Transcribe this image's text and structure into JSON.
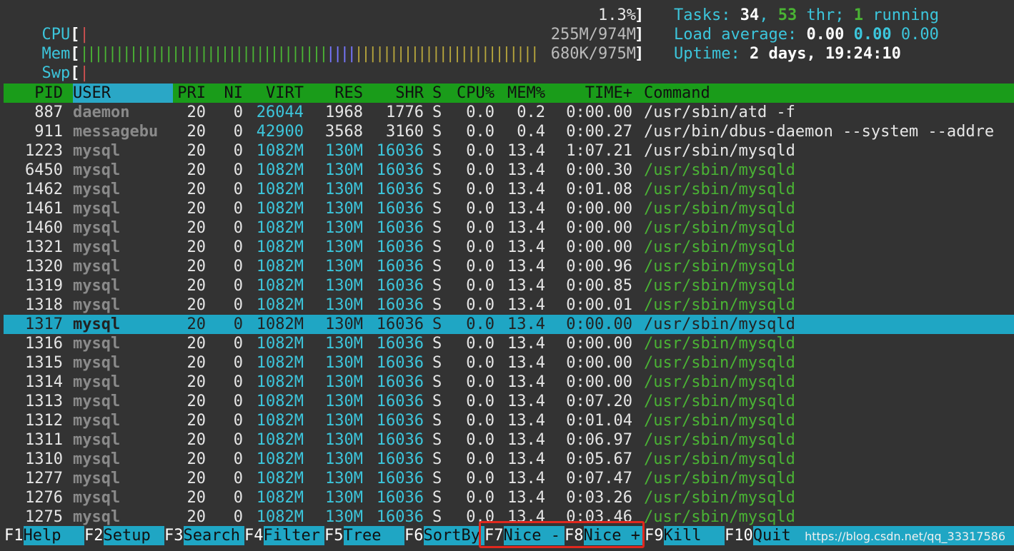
{
  "meters": {
    "cpu": {
      "label": "CPU",
      "percent": "1.3%"
    },
    "mem": {
      "label": "Mem",
      "value": "255M/974M"
    },
    "swp": {
      "label": "Swp",
      "value": "680K/975M"
    }
  },
  "summary": {
    "tasks_label": "Tasks:",
    "tasks": "34",
    "threads": "53",
    "thr_label": "thr;",
    "running": "1",
    "running_label": "running",
    "load_label": "Load average:",
    "load1": "0.00",
    "load5": "0.00",
    "load15": "0.00",
    "uptime_label": "Uptime:",
    "uptime": "2 days, 19:24:10"
  },
  "columns": {
    "pid": "PID",
    "user": "USER",
    "pri": "PRI",
    "ni": "NI",
    "virt": "VIRT",
    "res": "RES",
    "shr": "SHR",
    "s": "S",
    "cpu": "CPU%",
    "mem": "MEM%",
    "time": "TIME+",
    "command": "Command"
  },
  "processes": [
    {
      "pid": "887",
      "user": "daemon",
      "pri": "20",
      "ni": "0",
      "virt": "26044",
      "res": "1968",
      "shr": "1776",
      "s": "S",
      "cpu": "0.0",
      "mem": "0.2",
      "time": "0:00.00",
      "command": "/usr/sbin/atd -f",
      "thread": false
    },
    {
      "pid": "911",
      "user": "messagebu",
      "pri": "20",
      "ni": "0",
      "virt": "42900",
      "res": "3568",
      "shr": "3160",
      "s": "S",
      "cpu": "0.0",
      "mem": "0.4",
      "time": "0:00.27",
      "command": "/usr/bin/dbus-daemon --system --addre",
      "thread": false
    },
    {
      "pid": "1223",
      "user": "mysql",
      "pri": "20",
      "ni": "0",
      "virt": "1082M",
      "res": "130M",
      "shr": "16036",
      "s": "S",
      "cpu": "0.0",
      "mem": "13.4",
      "time": "1:07.21",
      "command": "/usr/sbin/mysqld",
      "thread": false
    },
    {
      "pid": "6450",
      "user": "mysql",
      "pri": "20",
      "ni": "0",
      "virt": "1082M",
      "res": "130M",
      "shr": "16036",
      "s": "S",
      "cpu": "0.0",
      "mem": "13.4",
      "time": "0:00.30",
      "command": "/usr/sbin/mysqld",
      "thread": true
    },
    {
      "pid": "1462",
      "user": "mysql",
      "pri": "20",
      "ni": "0",
      "virt": "1082M",
      "res": "130M",
      "shr": "16036",
      "s": "S",
      "cpu": "0.0",
      "mem": "13.4",
      "time": "0:01.08",
      "command": "/usr/sbin/mysqld",
      "thread": true
    },
    {
      "pid": "1461",
      "user": "mysql",
      "pri": "20",
      "ni": "0",
      "virt": "1082M",
      "res": "130M",
      "shr": "16036",
      "s": "S",
      "cpu": "0.0",
      "mem": "13.4",
      "time": "0:00.00",
      "command": "/usr/sbin/mysqld",
      "thread": true
    },
    {
      "pid": "1460",
      "user": "mysql",
      "pri": "20",
      "ni": "0",
      "virt": "1082M",
      "res": "130M",
      "shr": "16036",
      "s": "S",
      "cpu": "0.0",
      "mem": "13.4",
      "time": "0:00.00",
      "command": "/usr/sbin/mysqld",
      "thread": true
    },
    {
      "pid": "1321",
      "user": "mysql",
      "pri": "20",
      "ni": "0",
      "virt": "1082M",
      "res": "130M",
      "shr": "16036",
      "s": "S",
      "cpu": "0.0",
      "mem": "13.4",
      "time": "0:00.00",
      "command": "/usr/sbin/mysqld",
      "thread": true
    },
    {
      "pid": "1320",
      "user": "mysql",
      "pri": "20",
      "ni": "0",
      "virt": "1082M",
      "res": "130M",
      "shr": "16036",
      "s": "S",
      "cpu": "0.0",
      "mem": "13.4",
      "time": "0:00.96",
      "command": "/usr/sbin/mysqld",
      "thread": true
    },
    {
      "pid": "1319",
      "user": "mysql",
      "pri": "20",
      "ni": "0",
      "virt": "1082M",
      "res": "130M",
      "shr": "16036",
      "s": "S",
      "cpu": "0.0",
      "mem": "13.4",
      "time": "0:00.85",
      "command": "/usr/sbin/mysqld",
      "thread": true
    },
    {
      "pid": "1318",
      "user": "mysql",
      "pri": "20",
      "ni": "0",
      "virt": "1082M",
      "res": "130M",
      "shr": "16036",
      "s": "S",
      "cpu": "0.0",
      "mem": "13.4",
      "time": "0:00.01",
      "command": "/usr/sbin/mysqld",
      "thread": true
    },
    {
      "pid": "1317",
      "user": "mysql",
      "pri": "20",
      "ni": "0",
      "virt": "1082M",
      "res": "130M",
      "shr": "16036",
      "s": "S",
      "cpu": "0.0",
      "mem": "13.4",
      "time": "0:00.00",
      "command": "/usr/sbin/mysqld",
      "thread": true,
      "selected": true
    },
    {
      "pid": "1316",
      "user": "mysql",
      "pri": "20",
      "ni": "0",
      "virt": "1082M",
      "res": "130M",
      "shr": "16036",
      "s": "S",
      "cpu": "0.0",
      "mem": "13.4",
      "time": "0:00.00",
      "command": "/usr/sbin/mysqld",
      "thread": true
    },
    {
      "pid": "1315",
      "user": "mysql",
      "pri": "20",
      "ni": "0",
      "virt": "1082M",
      "res": "130M",
      "shr": "16036",
      "s": "S",
      "cpu": "0.0",
      "mem": "13.4",
      "time": "0:00.00",
      "command": "/usr/sbin/mysqld",
      "thread": true
    },
    {
      "pid": "1314",
      "user": "mysql",
      "pri": "20",
      "ni": "0",
      "virt": "1082M",
      "res": "130M",
      "shr": "16036",
      "s": "S",
      "cpu": "0.0",
      "mem": "13.4",
      "time": "0:00.00",
      "command": "/usr/sbin/mysqld",
      "thread": true
    },
    {
      "pid": "1313",
      "user": "mysql",
      "pri": "20",
      "ni": "0",
      "virt": "1082M",
      "res": "130M",
      "shr": "16036",
      "s": "S",
      "cpu": "0.0",
      "mem": "13.4",
      "time": "0:07.20",
      "command": "/usr/sbin/mysqld",
      "thread": true
    },
    {
      "pid": "1312",
      "user": "mysql",
      "pri": "20",
      "ni": "0",
      "virt": "1082M",
      "res": "130M",
      "shr": "16036",
      "s": "S",
      "cpu": "0.0",
      "mem": "13.4",
      "time": "0:01.04",
      "command": "/usr/sbin/mysqld",
      "thread": true
    },
    {
      "pid": "1311",
      "user": "mysql",
      "pri": "20",
      "ni": "0",
      "virt": "1082M",
      "res": "130M",
      "shr": "16036",
      "s": "S",
      "cpu": "0.0",
      "mem": "13.4",
      "time": "0:06.97",
      "command": "/usr/sbin/mysqld",
      "thread": true
    },
    {
      "pid": "1310",
      "user": "mysql",
      "pri": "20",
      "ni": "0",
      "virt": "1082M",
      "res": "130M",
      "shr": "16036",
      "s": "S",
      "cpu": "0.0",
      "mem": "13.4",
      "time": "0:05.67",
      "command": "/usr/sbin/mysqld",
      "thread": true
    },
    {
      "pid": "1277",
      "user": "mysql",
      "pri": "20",
      "ni": "0",
      "virt": "1082M",
      "res": "130M",
      "shr": "16036",
      "s": "S",
      "cpu": "0.0",
      "mem": "13.4",
      "time": "0:07.47",
      "command": "/usr/sbin/mysqld",
      "thread": true
    },
    {
      "pid": "1276",
      "user": "mysql",
      "pri": "20",
      "ni": "0",
      "virt": "1082M",
      "res": "130M",
      "shr": "16036",
      "s": "S",
      "cpu": "0.0",
      "mem": "13.4",
      "time": "0:03.26",
      "command": "/usr/sbin/mysqld",
      "thread": true
    },
    {
      "pid": "1275",
      "user": "mysql",
      "pri": "20",
      "ni": "0",
      "virt": "1082M",
      "res": "130M",
      "shr": "16036",
      "s": "S",
      "cpu": "0.0",
      "mem": "13.4",
      "time": "0:03.46",
      "command": "/usr/sbin/mysqld",
      "thread": true
    }
  ],
  "footer": [
    {
      "key": "F1",
      "label": "Help  "
    },
    {
      "key": "F2",
      "label": "Setup "
    },
    {
      "key": "F3",
      "label": "Search"
    },
    {
      "key": "F4",
      "label": "Filter"
    },
    {
      "key": "F5",
      "label": "Tree  "
    },
    {
      "key": "F6",
      "label": "SortBy"
    },
    {
      "key": "F7",
      "label": "Nice -"
    },
    {
      "key": "F8",
      "label": "Nice +"
    },
    {
      "key": "F9",
      "label": "Kill  "
    },
    {
      "key": "F10",
      "label": "Quit"
    }
  ],
  "watermark": "https://blog.csdn.net/qq_33317586",
  "colors": {
    "accent": "#3cc6dc",
    "header_bg": "#1a9c1a",
    "selected_bg": "#1fa6c4",
    "highlight_box": "#e0281e",
    "thread_cmd": "#4ab334"
  }
}
